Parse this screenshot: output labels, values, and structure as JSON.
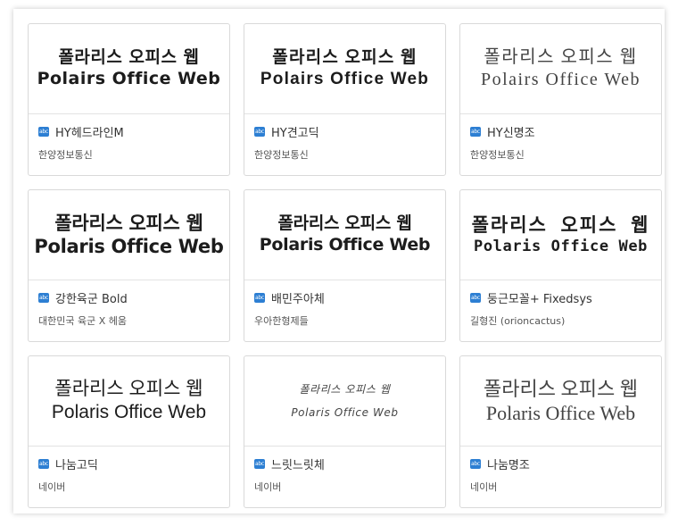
{
  "preview_text": {
    "line1": "폴라리스 오피스 웹"
  },
  "fonts": [
    {
      "line2": "Polairs Office Web",
      "name": "HY헤드라인M",
      "maker": "한양정보통신"
    },
    {
      "line2": "Polairs Office Web",
      "name": "HY견고딕",
      "maker": "한양정보통신"
    },
    {
      "line2": "Polairs Office Web",
      "name": "HY신명조",
      "maker": "한양정보통신"
    },
    {
      "line2": "Polaris Office Web",
      "name": "강한육군 Bold",
      "maker": "대한민국 육군 X 헤움"
    },
    {
      "line2": "Polaris Office Web",
      "name": "배민주아체",
      "maker": "우아한형제들"
    },
    {
      "line2": "Polaris Office Web",
      "name": "둥근모꼴+ Fixedsys",
      "maker": "길형진 (orioncactus)"
    },
    {
      "line2": "Polaris Office Web",
      "name": "나눔고딕",
      "maker": "네이버"
    },
    {
      "line2": "Polaris Office Web",
      "name": "느릿느릿체",
      "maker": "네이버"
    },
    {
      "line2": "Polaris Office Web",
      "name": "나눔명조",
      "maker": "네이버"
    }
  ],
  "icon_label": "abc",
  "icons": {
    "font_type": "abc-font-icon"
  },
  "colors": {
    "icon_blue": "#2d7fd3",
    "border": "#d9d9d9"
  }
}
